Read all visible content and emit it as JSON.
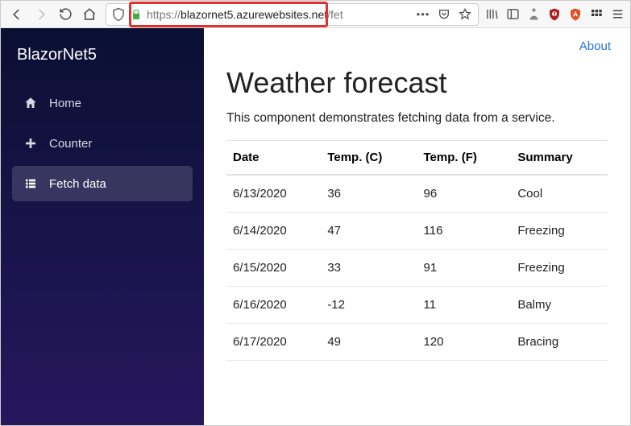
{
  "browser": {
    "url_prefix": "https://",
    "url_host": "blazornet5.azurewebsites.net",
    "url_path": "/fet"
  },
  "sidebar": {
    "brand": "BlazorNet5",
    "items": [
      {
        "label": "Home",
        "icon": "home-icon",
        "active": false
      },
      {
        "label": "Counter",
        "icon": "plus-icon",
        "active": false
      },
      {
        "label": "Fetch data",
        "icon": "list-icon",
        "active": true
      }
    ]
  },
  "topbar": {
    "about": "About"
  },
  "page": {
    "title": "Weather forecast",
    "lead": "This component demonstrates fetching data from a service."
  },
  "table": {
    "headers": [
      "Date",
      "Temp. (C)",
      "Temp. (F)",
      "Summary"
    ],
    "rows": [
      [
        "6/13/2020",
        "36",
        "96",
        "Cool"
      ],
      [
        "6/14/2020",
        "47",
        "116",
        "Freezing"
      ],
      [
        "6/15/2020",
        "33",
        "91",
        "Freezing"
      ],
      [
        "6/16/2020",
        "-12",
        "11",
        "Balmy"
      ],
      [
        "6/17/2020",
        "49",
        "120",
        "Bracing"
      ]
    ]
  }
}
